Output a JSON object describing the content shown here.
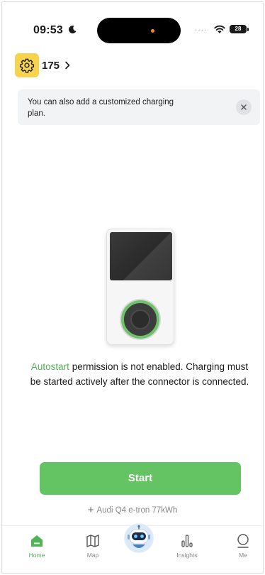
{
  "status_bar": {
    "time": "09:53",
    "battery": "28"
  },
  "header": {
    "station_number": "175"
  },
  "banner": {
    "text": "You can also add a customized charging plan."
  },
  "message": {
    "highlight": "Autostart",
    "rest": " permission is not enabled. Charging must be started actively after the connector is connected."
  },
  "start_button": {
    "label": "Start"
  },
  "vehicle": {
    "label": "Audi Q4 e-tron 77kWh"
  },
  "tabs": [
    {
      "label": "Home",
      "icon": "home-icon",
      "active": true
    },
    {
      "label": "Map",
      "icon": "map-icon",
      "active": false
    },
    {
      "label": "",
      "icon": "robot-assistant-icon",
      "active": false
    },
    {
      "label": "Insights",
      "icon": "insights-icon",
      "active": false
    },
    {
      "label": "Me",
      "icon": "me-icon",
      "active": false
    }
  ],
  "colors": {
    "accent_green": "#64c464",
    "highlight_green": "#52b356",
    "settings_yellow": "#f7d34e"
  }
}
